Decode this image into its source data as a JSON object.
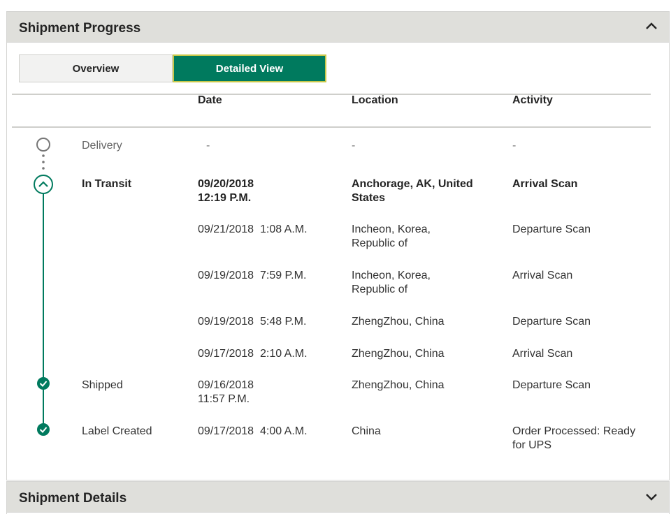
{
  "progress": {
    "title": "Shipment Progress",
    "collapse_icon": "chevron-up-icon"
  },
  "tabs": {
    "overview": "Overview",
    "detailed": "Detailed View",
    "active": "detailed"
  },
  "table": {
    "headers": {
      "status": "",
      "date": "Date",
      "location": "Location",
      "activity": "Activity"
    },
    "rows": [
      {
        "status": "Delivery",
        "date": "-",
        "location": "-",
        "activity": "-"
      },
      {
        "status": "In Transit",
        "date_line1": "09/20/2018",
        "date_line2": "12:19 P.M.",
        "location_line1": "Anchorage, AK, United",
        "location_line2": "States",
        "activity": "Arrival Scan"
      },
      {
        "date": "09/21/2018",
        "time": "1:08 A.M.",
        "location_line1": "Incheon, Korea,",
        "location_line2": "Republic of",
        "activity": "Departure Scan"
      },
      {
        "date": "09/19/2018",
        "time": "7:59 P.M.",
        "location_line1": "Incheon, Korea,",
        "location_line2": "Republic of",
        "activity": "Arrival Scan"
      },
      {
        "date": "09/19/2018",
        "time": "5:48 P.M.",
        "location": "ZhengZhou, China",
        "activity": "Departure Scan"
      },
      {
        "date": "09/17/2018",
        "time": "2:10 A.M.",
        "location": "ZhengZhou, China",
        "activity": "Arrival Scan"
      },
      {
        "status": "Shipped",
        "date_line1": "09/16/2018",
        "date_line2": "11:57 P.M.",
        "location": "ZhengZhou, China",
        "activity": "Departure Scan"
      },
      {
        "status": "Label Created",
        "date": "09/17/2018",
        "time": "4:00 A.M.",
        "location": "China",
        "activity_line1": "Order Processed: Ready",
        "activity_line2": "for UPS"
      }
    ]
  },
  "details": {
    "title": "Shipment Details",
    "expand_icon": "chevron-down-icon"
  },
  "colors": {
    "brand_green": "#007a5e",
    "header_gray": "#dfdfdb",
    "highlight_border": "#c8c84a"
  }
}
